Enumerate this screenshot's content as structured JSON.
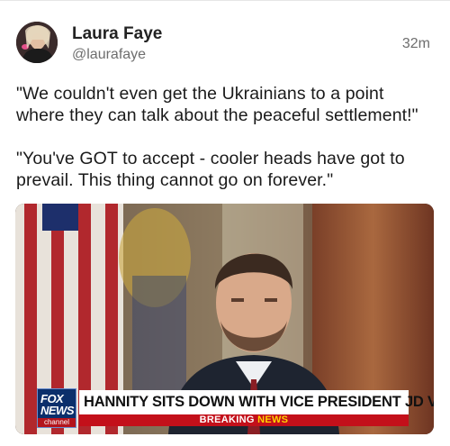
{
  "post": {
    "author_name": "Laura Faye",
    "author_handle": "@laurafaye",
    "time_ago": "32m",
    "paragraphs": [
      "\"We couldn't even get the Ukrainians to a point where they can talk about the peaceful settlement!\"",
      "\"You've GOT to accept - cooler heads have got to prevail. This thing cannot go on forever.\""
    ]
  },
  "media": {
    "chyron_headline": "HANNITY SITS DOWN WITH VICE PRESIDENT JD VANCE",
    "chyron_breaking": "BREAKING",
    "chyron_news": "NEWS",
    "logo_line1": "FOX",
    "logo_line2": "NEWS",
    "logo_line3": "channel"
  },
  "colors": {
    "fox_blue": "#0b2f6b",
    "breaking_red": "#c3101a",
    "news_yellow": "#ffd200"
  }
}
